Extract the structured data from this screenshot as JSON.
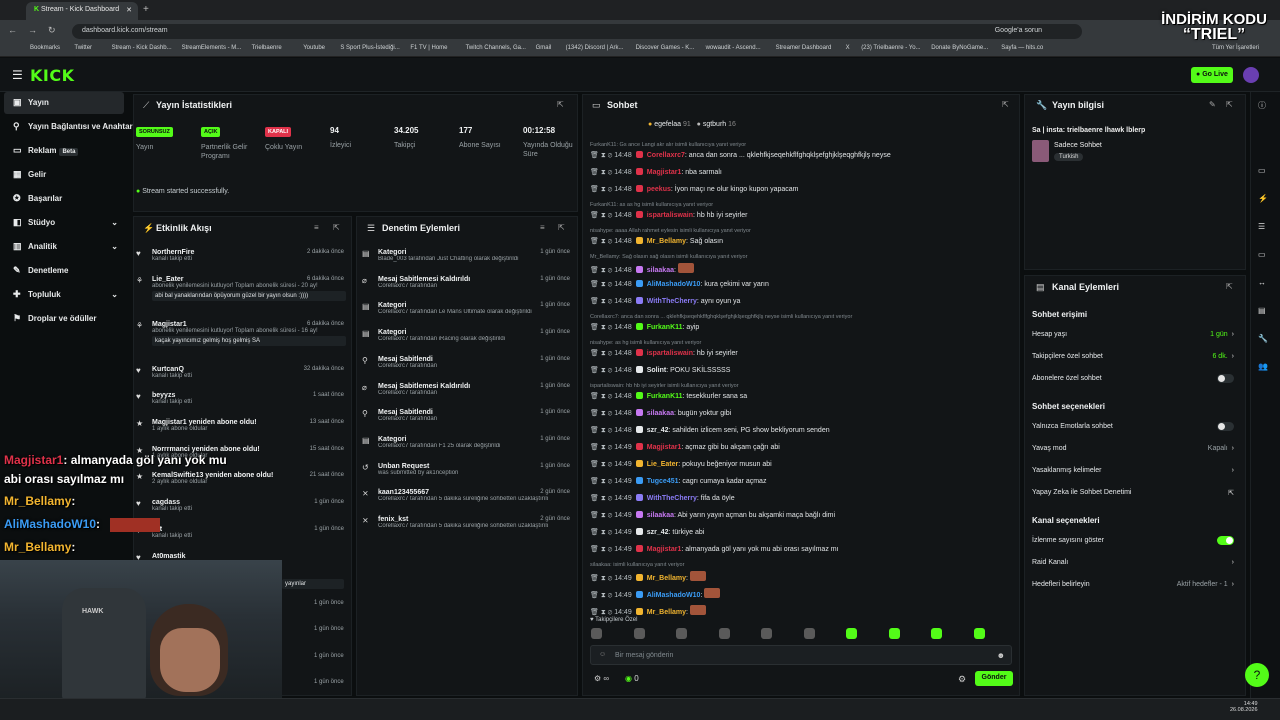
{
  "browser": {
    "tab_title": "Stream - Kick Dashboard",
    "url": "dashboard.kick.com/stream",
    "right_badge": "Google'a sorun",
    "bookmarks": [
      "Bookmarks",
      "Twitter",
      "Stream - Kick Dashb...",
      "StreamElements - M...",
      "Trielbaenre",
      "Youtube",
      "S Sport Plus-İstediği...",
      "F1 TV | Home",
      "Twitch Channels, Ga...",
      "Gmail",
      "(1342) Discord | Ark...",
      "Discover Games - K...",
      "wowaudit - Ascend...",
      "Streamer Dashboard",
      "X",
      "(23) Trielbaenre - Yo...",
      "Donate ByNoGame...",
      "Sayfa — hits.co"
    ],
    "bookmarks_right": "Tüm Yer İşaretleri"
  },
  "promo": {
    "line1": "İNDİRİM KODU",
    "line2": "“TRIEL”"
  },
  "header": {
    "logo": "KICK",
    "go_live": "Go Live"
  },
  "sidebar": {
    "items": [
      {
        "label": "Yayın",
        "icon": "stream-icon"
      },
      {
        "label": "Yayın Bağlantısı ve Anahtarı",
        "icon": "link-icon"
      },
      {
        "label": "Reklam",
        "icon": "ad-icon",
        "badge": "Beta"
      },
      {
        "label": "Gelir",
        "icon": "money-icon"
      },
      {
        "label": "Başarılar",
        "icon": "trophy-icon"
      },
      {
        "label": "Stüdyo",
        "icon": "studio-icon"
      },
      {
        "label": "Analitik",
        "icon": "analytics-icon"
      },
      {
        "label": "Denetleme",
        "icon": "moderation-icon"
      },
      {
        "label": "Topluluk",
        "icon": "community-icon"
      },
      {
        "label": "Droplar ve ödüller",
        "icon": "gift-icon"
      }
    ]
  },
  "stats": {
    "title": "Yayın İstatistikleri",
    "items": [
      {
        "badge": "SORUNSUZ",
        "label": "Yayın"
      },
      {
        "badge": "AÇIK",
        "label": "Partnerlik Gelir Programı"
      },
      {
        "badge": "KAPALI",
        "label": "Çoklu Yayın"
      },
      {
        "value": "94",
        "label": "İzleyici"
      },
      {
        "value": "34.205",
        "label": "Takipçi"
      },
      {
        "value": "177",
        "label": "Abone Sayısı"
      },
      {
        "value": "00:12:58",
        "label": "Yayında Olduğu Süre"
      }
    ],
    "toast": "Stream started successfully."
  },
  "activity": {
    "title": "Etkinlik Akışı",
    "rows": [
      {
        "name": "NorthernFire",
        "sub": "kanalı takip etti",
        "time": "2 dakika önce"
      },
      {
        "name": "Lie_Eater",
        "sub": "abonelik yenilemesini kutluyor! Toplam abonelik süresi - 20 ay!",
        "time": "6 dakika önce",
        "msg": "abi bal yanaklarından öpüyorum güzel bir yayın olsun :))))"
      },
      {
        "name": "Magjistar1",
        "sub": "abonelik yenilemesini kutluyor! Toplam abonelik süresi - 16 ay!",
        "time": "6 dakika önce",
        "msg": "kaçak yayıncımız gelmiş hoş gelmiş SA"
      },
      {
        "name": "KurtcanQ",
        "sub": "kanalı takip etti",
        "time": "32 dakika önce"
      },
      {
        "name": "beyyzs",
        "sub": "kanalı takip etti",
        "time": "1 saat önce"
      },
      {
        "name": "Magjistar1 yeniden abone oldu!",
        "sub": "1 aylık abone oldular",
        "time": "13 saat önce"
      },
      {
        "name": "Norrrmanci yeniden abone oldu!",
        "sub": "1 aylık abone oldular",
        "time": "15 saat önce"
      },
      {
        "name": "KemalSwiftie13 yeniden abone oldu!",
        "sub": "2 aylık abone oldular",
        "time": "21 saat önce"
      },
      {
        "name": "cagdass",
        "sub": "kanalı takip etti",
        "time": "1 gün önce"
      },
      {
        "name": "e_t",
        "sub": "kanalı takip etti",
        "time": "1 gün önce"
      },
      {
        "name": "At0mastik",
        "sub": "",
        "time": ""
      }
    ],
    "extra_times": [
      "1 gün önce",
      "1 gün önce",
      "1 gün önce",
      "1 gün önce"
    ],
    "extra_msg": "yayınlar"
  },
  "modlog": {
    "title": "Denetim Eylemleri",
    "rows": [
      {
        "title": "Kategori",
        "sub": "Blade_003 tarafından Just Chatting olarak değiştirildi",
        "time": "1 gün önce"
      },
      {
        "title": "Mesaj Sabitlemesi Kaldırıldı",
        "sub": "Corellaxrc7 tarafından",
        "time": "1 gün önce"
      },
      {
        "title": "Kategori",
        "sub": "Corellaxrc7 tarafından Le Mans Ultimate olarak değiştirildi",
        "time": "1 gün önce"
      },
      {
        "title": "Kategori",
        "sub": "Corellaxrc7 tarafından iRacing olarak değiştirildi",
        "time": "1 gün önce"
      },
      {
        "title": "Mesaj Sabitlendi",
        "sub": "Corellaxrc7 tarafından",
        "time": "1 gün önce"
      },
      {
        "title": "Mesaj Sabitlemesi Kaldırıldı",
        "sub": "Corellaxrc7 tarafından",
        "time": "1 gün önce"
      },
      {
        "title": "Mesaj Sabitlendi",
        "sub": "Corellaxrc7 tarafından",
        "time": "1 gün önce"
      },
      {
        "title": "Kategori",
        "sub": "Corellaxrc7 tarafından F1 25 olarak değiştirildi",
        "time": "1 gün önce"
      },
      {
        "title": "Unban Request",
        "sub": "was submitted by ak1nception",
        "time": "1 gün önce"
      },
      {
        "title": "kaan123455667",
        "sub": "Corellaxrc7 tarafından 5 dakika süreliğine sohbetten uzaklaştırıldı",
        "time": "2 gün önce"
      },
      {
        "title": "fenix_kst",
        "sub": "Corellaxrc7 tarafından 5 dakika süreliğine sohbetten uzaklaştırıldı",
        "time": "2 gün önce"
      }
    ]
  },
  "chat": {
    "title": "Sohbet",
    "top_users": [
      {
        "name": "egefelaa",
        "count": "91"
      },
      {
        "name": "sgtburh",
        "count": "16"
      }
    ],
    "lines": [
      {
        "reply": "FurkanK11: Gs ance Langi akr alır isimli kullanıcıya yanıt veriyor"
      },
      {
        "time": "14:48",
        "user": "Corellaxrc7",
        "color": "#e0324a",
        "msg": "anca dan sonra ... qklehfkjseqehkflfghqklşefghjklşeqghfkjlş neyse"
      },
      {
        "time": "14:48",
        "user": "Magjistar1",
        "color": "#e0324a",
        "msg": "nba sarmalı"
      },
      {
        "time": "14:48",
        "user": "peekus",
        "color": "#e0324a",
        "msg": "İyon maçı ne olur kingo kupon yapacam"
      },
      {
        "reply": "FurkanK11: as as hg isimli kullanıcıya yanıt veriyor"
      },
      {
        "time": "14:48",
        "user": "ispartaliswain",
        "color": "#e0324a",
        "msg": "hb hb iyi seyirler"
      },
      {
        "reply": "nisahype: aaaa Allah rahmet eylesin isimli kullanıcıya yanıt veriyor"
      },
      {
        "time": "14:48",
        "user": "Mr_Bellamy",
        "color": "#f2b530",
        "msg": "Sağ olasın"
      },
      {
        "reply": "Mr_Bellamy: Sağ olasın sağ olasın isimli kullanıcıya yanıt veriyor"
      },
      {
        "time": "14:48",
        "user": "silaakaa",
        "color": "#c779f2",
        "msg": ""
      },
      {
        "time": "14:48",
        "user": "AliMashadoW10",
        "color": "#3b9cf5",
        "msg": "kura çekimi var yarın"
      },
      {
        "time": "14:48",
        "user": "WithTheCherry",
        "color": "#8b7cf6",
        "msg": "aynı oyun ya"
      },
      {
        "reply": "Corellaxrc7: anca dan sonra ... qklehfkjseqehkflfghqklşefghjklşeqghfkjlş neyse isimli kullanıcıya yanıt veriyor"
      },
      {
        "time": "14:48",
        "user": "FurkanK11",
        "color": "#53fc18",
        "msg": "ayip"
      },
      {
        "reply": "nisahype: as hg isimli kullanıcıya yanıt veriyor"
      },
      {
        "time": "14:48",
        "user": "ispartaliswain",
        "color": "#e0324a",
        "msg": "hb iyi seyirler"
      },
      {
        "time": "14:48",
        "user": "Solint",
        "color": "#e6e9eb",
        "msg": "POKU SKİLSSSSS"
      },
      {
        "reply": "ispartaliswain: hb hb iyi seyirler isimli kullanıcıya yanıt veriyor"
      },
      {
        "time": "14:48",
        "user": "FurkanK11",
        "color": "#53fc18",
        "msg": "tesekkurler sana sa"
      },
      {
        "time": "14:48",
        "user": "silaakaa",
        "color": "#c779f2",
        "msg": "bugün yoktur gibi"
      },
      {
        "time": "14:48",
        "user": "szr_42",
        "color": "#e6e9eb",
        "msg": "sahilden izlicem seni, PG show bekliyorum senden"
      },
      {
        "time": "14:49",
        "user": "Magjistar1",
        "color": "#e0324a",
        "msg": "açmaz gibi bu akşam çağrı abi"
      },
      {
        "time": "14:49",
        "user": "Lie_Eater",
        "color": "#f2b530",
        "msg": "pokuyu beğeniyor musun abi"
      },
      {
        "time": "14:49",
        "user": "Tugce451",
        "color": "#3b9cf5",
        "msg": "cagrı cumaya kadar açmaz"
      },
      {
        "time": "14:49",
        "user": "WithTheCherry",
        "color": "#8b7cf6",
        "msg": "fifa da öyle"
      },
      {
        "time": "14:49",
        "user": "silaakaa",
        "color": "#c779f2",
        "msg": "Abi yarın yayın açman bu akşamki maça bağlı dimi"
      },
      {
        "time": "14:49",
        "user": "szr_42",
        "color": "#e6e9eb",
        "msg": "türkiye abi"
      },
      {
        "time": "14:49",
        "user": "Magjistar1",
        "color": "#e0324a",
        "msg": "almanyada göl yanı yok mu abi orası sayılmaz mı"
      },
      {
        "reply": "silaakaa: isimli kullanıcıya yanıt veriyor"
      },
      {
        "time": "14:49",
        "user": "Mr_Bellamy",
        "color": "#f2b530",
        "msg": ""
      },
      {
        "time": "14:49",
        "user": "AliMashadoW10",
        "color": "#3b9cf5",
        "msg": ""
      },
      {
        "time": "14:49",
        "user": "Mr_Bellamy",
        "color": "#f2b530",
        "msg": ""
      }
    ],
    "followers_only": "Takipçilere Özel",
    "placeholder": "Bir mesaj gönderin",
    "points": "0",
    "send": "Gönder"
  },
  "stream_info": {
    "title": "Yayın bilgisi",
    "stream_title": "Sa | insta: trielbaenre lhawk lblerp",
    "category": "Sadece Sohbet",
    "language": "Turkish"
  },
  "channel": {
    "title": "Kanal Eylemleri",
    "chat_access": {
      "heading": "Sohbet erişimi",
      "items": [
        {
          "label": "Hesap yaşı",
          "value": "1 gün"
        },
        {
          "label": "Takipçilere özel sohbet",
          "value": "6 dk."
        },
        {
          "label": "Abonelere özel sohbet",
          "toggle": false
        }
      ]
    },
    "chat_options": {
      "heading": "Sohbet seçenekleri",
      "items": [
        {
          "label": "Yalnızca Emotlarla sohbet",
          "toggle": false
        },
        {
          "label": "Yavaş mod",
          "value": "Kapalı"
        },
        {
          "label": "Yasaklanmış kelimeler",
          "value": ""
        },
        {
          "label": "Yapay Zeka ile Sohbet Denetimi",
          "value": ""
        }
      ]
    },
    "channel_options": {
      "heading": "Kanal seçenekleri",
      "items": [
        {
          "label": "İzlenme sayısını göster",
          "toggle": true
        },
        {
          "label": "Raid Kanalı",
          "value": ""
        },
        {
          "label": "Hedefleri belirleyin",
          "value": "Aktif hedefler - 1"
        }
      ]
    }
  },
  "overlay": {
    "lines": [
      {
        "user": "Magjistar1",
        "msg": ": almanyada göl yanı yok mu"
      },
      {
        "user": "",
        "msg": "abi orası sayılmaz mı"
      },
      {
        "user": "Mr_Bellamy",
        "msg": ":"
      },
      {
        "user": "AliMashadoW10",
        "msg": ":"
      },
      {
        "user": "Mr_Bellamy",
        "msg": ":"
      }
    ],
    "cam_logo": "HAWK"
  },
  "taskbar": {
    "time": "14:49",
    "date": "26.08.2026"
  },
  "colors": {
    "accent": "#53fc18",
    "panel": "#121517",
    "bg": "#0b0e0f"
  }
}
